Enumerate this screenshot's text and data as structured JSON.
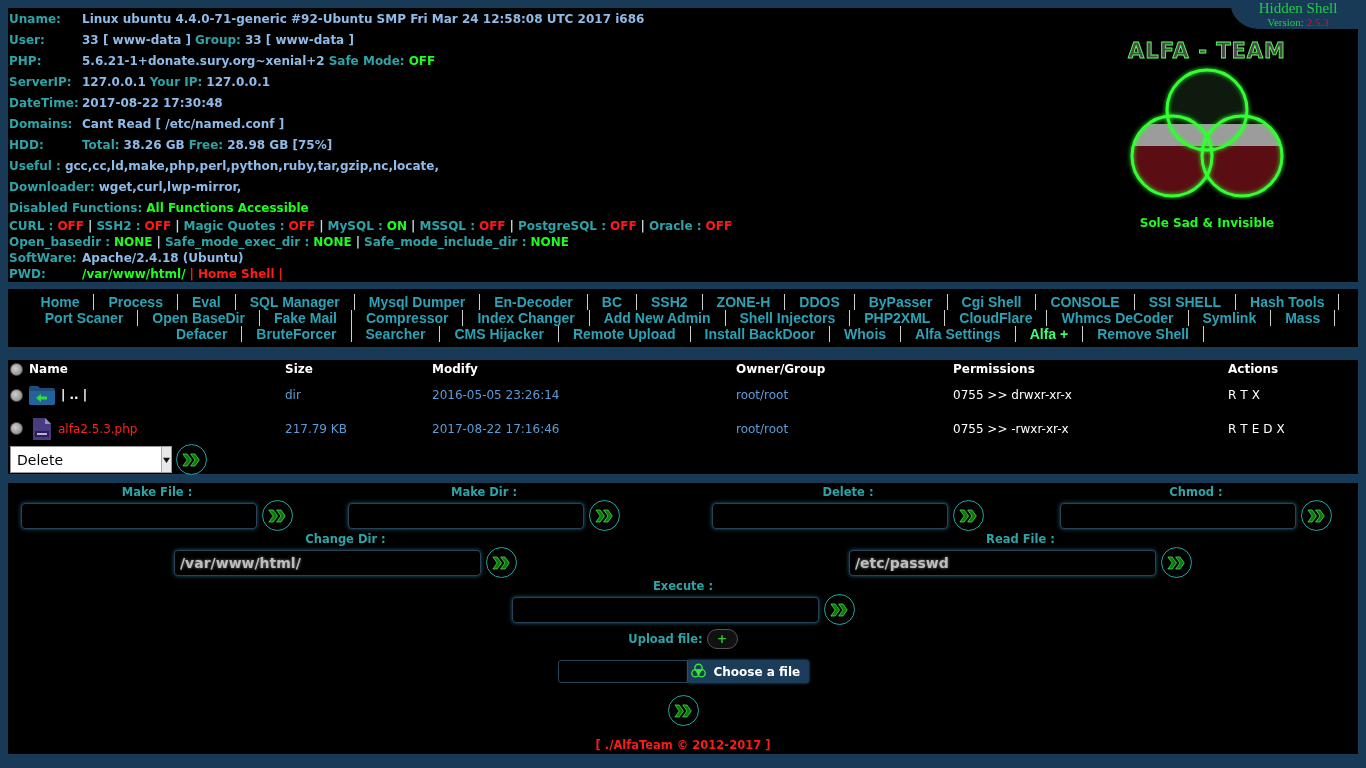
{
  "badge": {
    "title": "Hidden Shell",
    "version_label": "Version:",
    "version": "2.5.3"
  },
  "info": [
    {
      "kind": "field",
      "label": "Uname:",
      "parts": [
        {
          "text": "Linux ubuntu 4.4.0-71-generic #92-Ubuntu SMP Fri Mar 24 12:58:08 UTC 2017 i686",
          "kind": "value"
        }
      ]
    },
    {
      "kind": "field",
      "label": "User:",
      "parts": [
        {
          "text": "33 [ www-data ]",
          "kind": "value"
        },
        {
          "text": "Group:",
          "kind": "label"
        },
        {
          "text": "33 [ www-data ]",
          "kind": "value"
        }
      ]
    },
    {
      "kind": "field",
      "label": "PHP:",
      "parts": [
        {
          "text": "5.6.21-1+donate.sury.org~xenial+2",
          "kind": "value"
        },
        {
          "text": "Safe Mode:",
          "kind": "label"
        },
        {
          "text": "OFF",
          "kind": "good"
        }
      ]
    },
    {
      "kind": "field",
      "label": "ServerIP:",
      "parts": [
        {
          "text": "127.0.0.1",
          "kind": "value"
        },
        {
          "text": "Your IP:",
          "kind": "label"
        },
        {
          "text": "127.0.0.1",
          "kind": "value"
        }
      ]
    },
    {
      "kind": "field",
      "label": "DateTime:",
      "parts": [
        {
          "text": "2017-08-22 17:30:48",
          "kind": "value"
        }
      ]
    },
    {
      "kind": "field",
      "label": "Domains:",
      "parts": [
        {
          "text": "Cant Read [ /etc/named.conf ]",
          "kind": "value"
        }
      ]
    },
    {
      "kind": "field",
      "label": "HDD:",
      "parts": [
        {
          "text": "Total:",
          "kind": "label"
        },
        {
          "text": "38.26 GB",
          "kind": "value"
        },
        {
          "text": "Free:",
          "kind": "label"
        },
        {
          "text": "28.98 GB [75%]",
          "kind": "value"
        }
      ]
    },
    {
      "kind": "inline",
      "label": "Useful :",
      "parts": [
        {
          "text": "gcc,cc,ld,make,php,perl,python,ruby,tar,gzip,nc,locate,",
          "kind": "value"
        }
      ]
    },
    {
      "kind": "inline",
      "label": "Downloader:",
      "parts": [
        {
          "text": "wget,curl,lwp-mirror,",
          "kind": "value"
        }
      ]
    },
    {
      "kind": "inline",
      "label": "Disabled Functions:",
      "parts": [
        {
          "text": "All Functions Accessible",
          "kind": "good"
        }
      ]
    }
  ],
  "status": [
    {
      "kind": "inline",
      "label": "CURL :",
      "parts": [
        {
          "text": "OFF",
          "kind": "bad"
        },
        {
          "text": "|",
          "kind": "sep"
        },
        {
          "text": "SSH2 :",
          "kind": "label"
        },
        {
          "text": "OFF",
          "kind": "bad"
        },
        {
          "text": "|",
          "kind": "sep"
        },
        {
          "text": "Magic Quotes :",
          "kind": "label"
        },
        {
          "text": "OFF",
          "kind": "bad"
        },
        {
          "text": "|",
          "kind": "sep"
        },
        {
          "text": "MySQL :",
          "kind": "label"
        },
        {
          "text": "ON",
          "kind": "good"
        },
        {
          "text": "|",
          "kind": "sep"
        },
        {
          "text": "MSSQL :",
          "kind": "label"
        },
        {
          "text": "OFF",
          "kind": "bad"
        },
        {
          "text": "|",
          "kind": "sep"
        },
        {
          "text": "PostgreSQL :",
          "kind": "label"
        },
        {
          "text": "OFF",
          "kind": "bad"
        },
        {
          "text": "|",
          "kind": "sep"
        },
        {
          "text": "Oracle :",
          "kind": "label"
        },
        {
          "text": "OFF",
          "kind": "bad"
        }
      ]
    },
    {
      "kind": "inline",
      "label": "Open_basedir :",
      "parts": [
        {
          "text": "NONE",
          "kind": "good"
        },
        {
          "text": "|",
          "kind": "sep"
        },
        {
          "text": "Safe_mode_exec_dir :",
          "kind": "label"
        },
        {
          "text": "NONE",
          "kind": "good"
        },
        {
          "text": "|",
          "kind": "sep"
        },
        {
          "text": "Safe_mode_include_dir :",
          "kind": "label"
        },
        {
          "text": "NONE",
          "kind": "good"
        }
      ]
    },
    {
      "kind": "field",
      "label": "SoftWare:",
      "parts": [
        {
          "text": "Apache/2.4.18 (Ubuntu)",
          "kind": "value"
        }
      ]
    },
    {
      "kind": "field",
      "label": "PWD:",
      "parts": [
        {
          "text": "/var/www/html/",
          "kind": "path"
        },
        {
          "text": "|",
          "kind": "divider"
        },
        {
          "text": "Home Shell",
          "kind": "link"
        },
        {
          "text": "|",
          "kind": "divider"
        }
      ]
    }
  ],
  "logo": {
    "text": "ALFA - TEAM"
  },
  "tagline": "Sole Sad & Invisible",
  "menu": {
    "items": [
      {
        "label": "Home",
        "selected": false
      },
      {
        "label": "Process",
        "selected": false
      },
      {
        "label": "Eval",
        "selected": false
      },
      {
        "label": "SQL Manager",
        "selected": false
      },
      {
        "label": "Mysql Dumper",
        "selected": false
      },
      {
        "label": "En-Decoder",
        "selected": false
      },
      {
        "label": "BC",
        "selected": false
      },
      {
        "label": "SSH2",
        "selected": false
      },
      {
        "label": "ZONE-H",
        "selected": false
      },
      {
        "label": "DDOS",
        "selected": false
      },
      {
        "label": "ByPasser",
        "selected": false
      },
      {
        "label": "Cgi Shell",
        "selected": false
      },
      {
        "label": "CONSOLE",
        "selected": false
      },
      {
        "label": "SSI SHELL",
        "selected": false
      },
      {
        "label": "Hash Tools",
        "selected": false
      },
      {
        "label": "Port Scaner",
        "selected": false
      },
      {
        "label": "Open BaseDir",
        "selected": false
      },
      {
        "label": "Fake Mail",
        "selected": false
      },
      {
        "label": "Compressor",
        "selected": false
      },
      {
        "label": "Index Changer",
        "selected": false
      },
      {
        "label": "Add New Admin",
        "selected": false
      },
      {
        "label": "Shell Injectors",
        "selected": false
      },
      {
        "label": "PHP2XML",
        "selected": false
      },
      {
        "label": "CloudFlare",
        "selected": false
      },
      {
        "label": "Whmcs DeCoder",
        "selected": false
      },
      {
        "label": "Symlink",
        "selected": false
      },
      {
        "label": "Mass",
        "selected": false
      },
      {
        "label": "Defacer",
        "selected": false
      },
      {
        "label": "BruteForcer",
        "selected": false
      },
      {
        "label": "Searcher",
        "selected": false
      },
      {
        "label": "CMS Hijacker",
        "selected": false
      },
      {
        "label": "Remote Upload",
        "selected": false
      },
      {
        "label": "Install BackDoor",
        "selected": false
      },
      {
        "label": "Whois",
        "selected": false
      },
      {
        "label": "Alfa Settings",
        "selected": false
      },
      {
        "label": "Alfa +",
        "selected": true
      },
      {
        "label": "Remove Shell",
        "selected": false
      }
    ]
  },
  "files": {
    "columns": [
      "Name",
      "Size",
      "Modify",
      "Owner/Group",
      "Permissions",
      "Actions"
    ],
    "select_all": {
      "checked": false
    },
    "rows": [
      {
        "kind": "folder",
        "checked": false,
        "name": "| .. |",
        "size": "dir",
        "modified": "2016-05-05 23:26:14",
        "owner": "root/root",
        "permissions": "0755 >> drwxr-xr-x",
        "actions": [
          "R",
          "T",
          "X"
        ]
      },
      {
        "kind": "file",
        "checked": false,
        "name": "alfa2.5.3.php",
        "size": "217.79 KB",
        "modified": "2017-08-22 17:16:46",
        "owner": "root/root",
        "permissions": "0755 >> -rwxr-xr-x",
        "actions": [
          "R",
          "T",
          "E",
          "D",
          "X"
        ]
      }
    ],
    "bulk_action": {
      "value": "Delete"
    }
  },
  "tools": {
    "rows": [
      {
        "fields": [
          {
            "label": "Make File :"
          },
          {
            "label": "Make Dir :"
          },
          {
            "label": "Delete :"
          },
          {
            "label": "Chmod :"
          }
        ]
      },
      {
        "fields": [
          {
            "label": "Change Dir :",
            "value": "/var/www/html/"
          },
          {
            "label": "Read File :",
            "value": "/etc/passwd"
          }
        ]
      },
      {
        "fields": [
          {
            "label": "Execute :"
          }
        ]
      }
    ],
    "upload": {
      "label": "Upload file:",
      "add": "+",
      "choose": "Choose a file"
    }
  },
  "footer": "[ ./AlfaTeam © 2012-2017 ]"
}
